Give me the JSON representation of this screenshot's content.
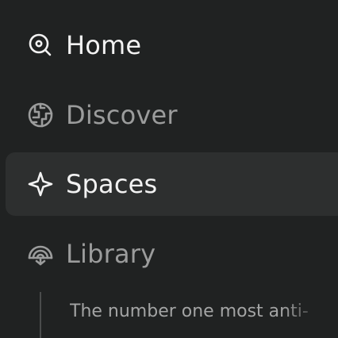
{
  "sidebar": {
    "items": [
      {
        "label": "Home",
        "icon": "search-icon",
        "active": false
      },
      {
        "label": "Discover",
        "icon": "globe-icon",
        "active": false
      },
      {
        "label": "Spaces",
        "icon": "sparkle-icon",
        "active": true
      },
      {
        "label": "Library",
        "icon": "library-icon",
        "active": false
      }
    ],
    "library_threads": [
      {
        "title": "The number one most anti-"
      }
    ]
  }
}
